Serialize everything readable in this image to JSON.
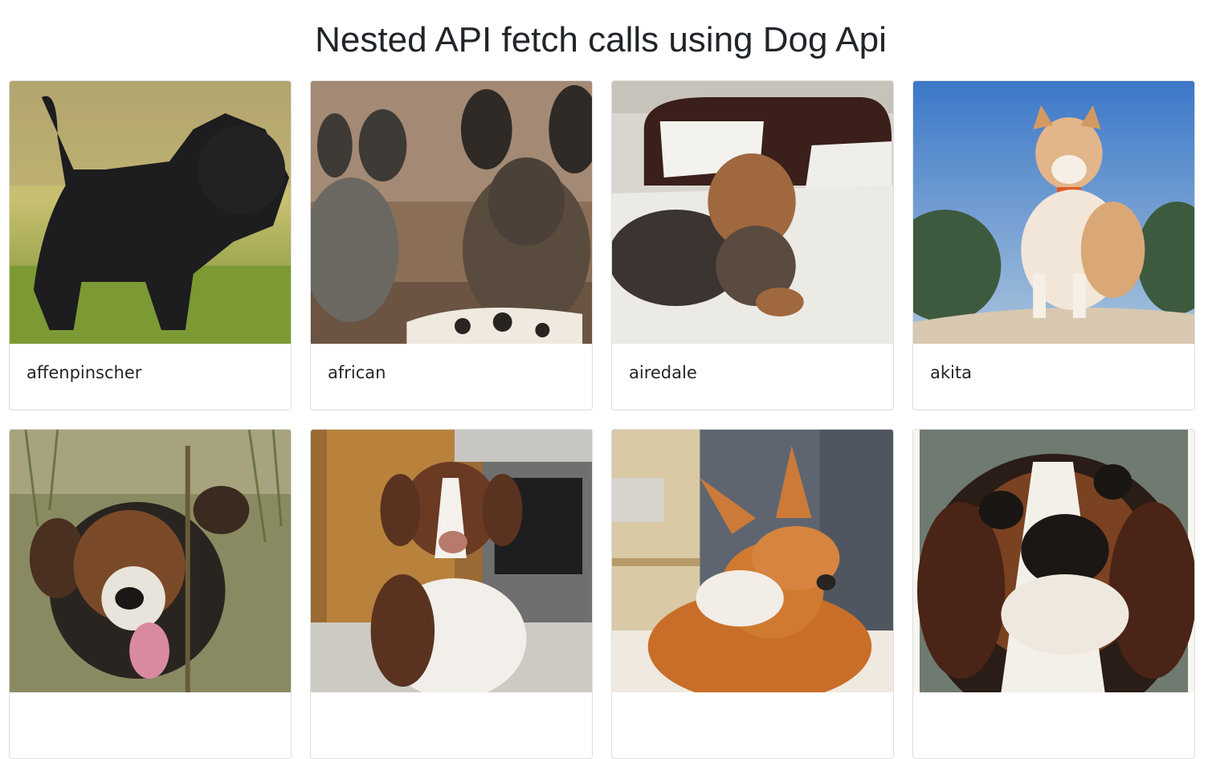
{
  "header": {
    "title": "Nested API fetch calls using Dog Api"
  },
  "cards": [
    {
      "breed": "affenpinscher",
      "image_icon": "black-scruffy-dog-photo"
    },
    {
      "breed": "african",
      "image_icon": "african-wild-dogs-photo"
    },
    {
      "breed": "airedale",
      "image_icon": "curly-dog-on-bed-photo"
    },
    {
      "breed": "akita",
      "image_icon": "akita-on-sand-photo"
    },
    {
      "breed": "",
      "image_icon": "tricolor-dog-in-grass-photo"
    },
    {
      "breed": "",
      "image_icon": "brown-white-shepherd-photo"
    },
    {
      "breed": "",
      "image_icon": "basenji-in-sun-photo"
    },
    {
      "breed": "",
      "image_icon": "beagle-closeup-photo"
    }
  ]
}
